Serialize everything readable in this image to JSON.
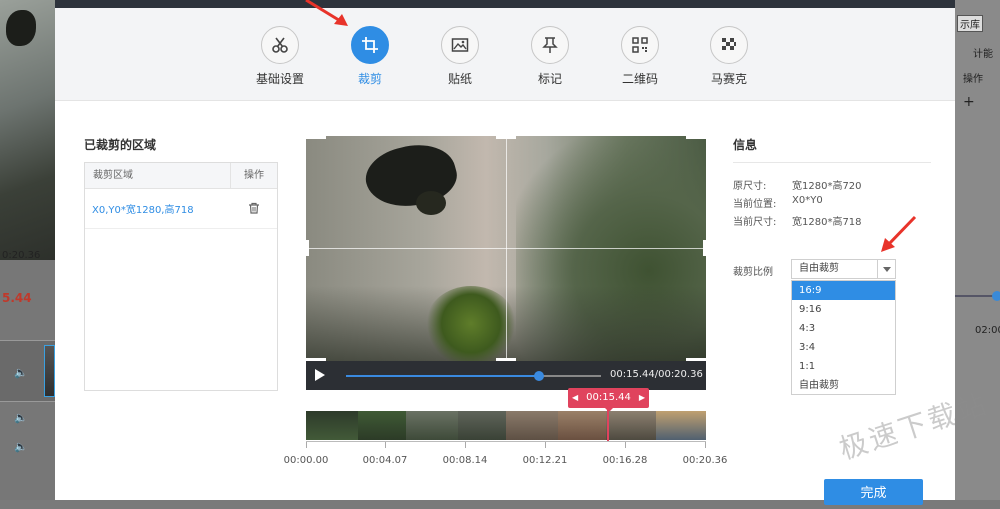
{
  "background": {
    "left_time": "0:20.36",
    "left_current": "5.44",
    "right_tab_label": "示库",
    "right_text_1": "计能",
    "right_text_2": "操作",
    "right_time": "02:00"
  },
  "toolbar": {
    "items": [
      {
        "label": "基础设置",
        "icon": "scissors-icon"
      },
      {
        "label": "裁剪",
        "icon": "crop-icon"
      },
      {
        "label": "贴纸",
        "icon": "image-icon"
      },
      {
        "label": "标记",
        "icon": "pin-icon"
      },
      {
        "label": "二维码",
        "icon": "qrcode-icon"
      },
      {
        "label": "马赛克",
        "icon": "mosaic-icon"
      }
    ],
    "active_index": 1
  },
  "left_panel": {
    "title": "已裁剪的区域",
    "col_region": "裁剪区域",
    "col_action": "操作",
    "rows": [
      {
        "region": "X0,Y0*宽1280,高718"
      }
    ]
  },
  "player": {
    "time": "00:15.44/00:20.36",
    "progress": 0.757,
    "marker_time": "00:15.44"
  },
  "timeline": {
    "labels": [
      "00:00.00",
      "00:04.07",
      "00:08.14",
      "00:12.21",
      "00:16.28",
      "00:20.36"
    ]
  },
  "info": {
    "title": "信息",
    "original_size_label": "原尺寸:",
    "original_size_value": "宽1280*高720",
    "position_label": "当前位置:",
    "position_value": "X0*Y0",
    "current_size_label": "当前尺寸:",
    "current_size_value": "宽1280*高718",
    "ratio_label": "裁剪比例",
    "ratio_selected": "自由裁剪",
    "ratio_options": [
      "16:9",
      "9:16",
      "4:3",
      "3:4",
      "1:1",
      "自由裁剪"
    ],
    "highlighted_option_index": 0
  },
  "finish_button": "完成",
  "watermark": "极速下载站",
  "colors": {
    "accent": "#2f8de4",
    "marker": "#e0435d",
    "annotation_arrow": "#e8332a"
  }
}
